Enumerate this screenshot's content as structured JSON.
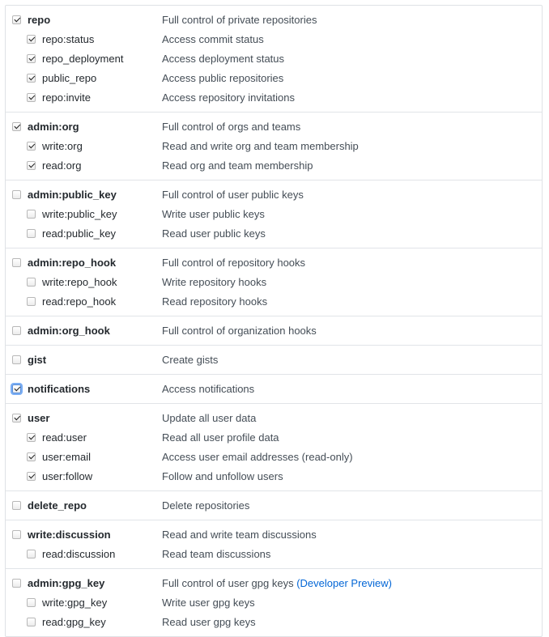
{
  "groups": [
    {
      "parent": {
        "name": "repo",
        "description": "Full control of private repositories",
        "checked": true
      },
      "children": [
        {
          "name": "repo:status",
          "description": "Access commit status",
          "checked": true
        },
        {
          "name": "repo_deployment",
          "description": "Access deployment status",
          "checked": true
        },
        {
          "name": "public_repo",
          "description": "Access public repositories",
          "checked": true
        },
        {
          "name": "repo:invite",
          "description": "Access repository invitations",
          "checked": true
        }
      ]
    },
    {
      "parent": {
        "name": "admin:org",
        "description": "Full control of orgs and teams",
        "checked": true
      },
      "children": [
        {
          "name": "write:org",
          "description": "Read and write org and team membership",
          "checked": true
        },
        {
          "name": "read:org",
          "description": "Read org and team membership",
          "checked": true
        }
      ]
    },
    {
      "parent": {
        "name": "admin:public_key",
        "description": "Full control of user public keys",
        "checked": false
      },
      "children": [
        {
          "name": "write:public_key",
          "description": "Write user public keys",
          "checked": false
        },
        {
          "name": "read:public_key",
          "description": "Read user public keys",
          "checked": false
        }
      ]
    },
    {
      "parent": {
        "name": "admin:repo_hook",
        "description": "Full control of repository hooks",
        "checked": false
      },
      "children": [
        {
          "name": "write:repo_hook",
          "description": "Write repository hooks",
          "checked": false
        },
        {
          "name": "read:repo_hook",
          "description": "Read repository hooks",
          "checked": false
        }
      ]
    },
    {
      "parent": {
        "name": "admin:org_hook",
        "description": "Full control of organization hooks",
        "checked": false
      },
      "children": []
    },
    {
      "parent": {
        "name": "gist",
        "description": "Create gists",
        "checked": false
      },
      "children": []
    },
    {
      "parent": {
        "name": "notifications",
        "description": "Access notifications",
        "checked": true,
        "focused": true
      },
      "children": []
    },
    {
      "parent": {
        "name": "user",
        "description": "Update all user data",
        "checked": true
      },
      "children": [
        {
          "name": "read:user",
          "description": "Read all user profile data",
          "checked": true
        },
        {
          "name": "user:email",
          "description": "Access user email addresses (read-only)",
          "checked": true
        },
        {
          "name": "user:follow",
          "description": "Follow and unfollow users",
          "checked": true
        }
      ]
    },
    {
      "parent": {
        "name": "delete_repo",
        "description": "Delete repositories",
        "checked": false
      },
      "children": []
    },
    {
      "parent": {
        "name": "write:discussion",
        "description": "Read and write team discussions",
        "checked": false
      },
      "children": [
        {
          "name": "read:discussion",
          "description": "Read team discussions",
          "checked": false
        }
      ]
    },
    {
      "parent": {
        "name": "admin:gpg_key",
        "description": "Full control of user gpg keys",
        "preview_label": "(Developer Preview)",
        "checked": false
      },
      "children": [
        {
          "name": "write:gpg_key",
          "description": "Write user gpg keys",
          "checked": false
        },
        {
          "name": "read:gpg_key",
          "description": "Read user gpg keys",
          "checked": false
        }
      ]
    }
  ]
}
